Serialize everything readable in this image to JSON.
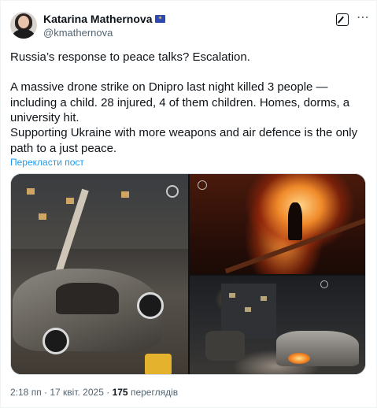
{
  "author": {
    "name": "Katarina Mathernova",
    "handle": "@kmathernova",
    "flag_icon": "eu-flag-icon"
  },
  "header_actions": {
    "grok_icon": "grok-icon",
    "more_icon": "more-options-icon",
    "more_glyph": "⋯"
  },
  "tweet": {
    "paragraph_1": "Russia’s response to peace talks? Escalation.",
    "paragraph_2": "A massive drone strike on Dnipro last night killed 3 people — including a child. 28 injured, 4 of them children. Homes, dorms, a university hit.",
    "paragraph_3": "Supporting Ukraine with more weapons and air defence is the only path to a just peace.",
    "translate_link": "Перекласти пост"
  },
  "media": {
    "count": 3,
    "descriptions": [
      "burned-out car after drone strike",
      "firefighter at burning building",
      "damaged cars at night with firefighter"
    ]
  },
  "meta": {
    "time": "2:18 пп",
    "separator": "·",
    "date": "17 квіт. 2025",
    "views_count": "175",
    "views_label": "переглядів"
  },
  "colors": {
    "link": "#1d9bf0",
    "secondary_text": "#536471",
    "primary_text": "#0f1419"
  }
}
